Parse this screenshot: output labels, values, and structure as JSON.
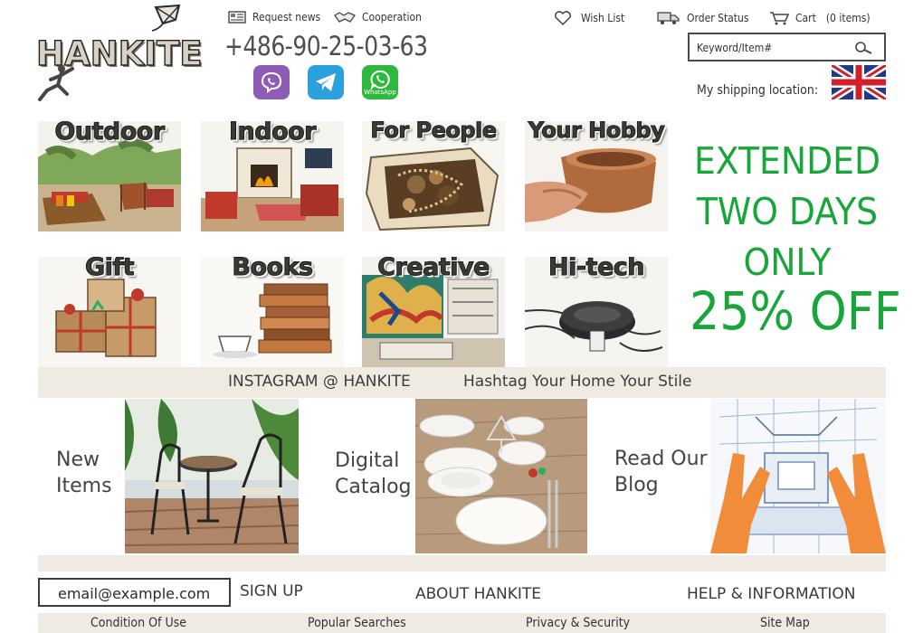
{
  "header": {
    "logo_text": "HANKITE",
    "links": {
      "request_news": "Request news",
      "cooperation": "Cooperation",
      "wish_list": "Wish List",
      "order_status": "Order Status",
      "cart": "Cart",
      "cart_count": "(0  items)"
    },
    "phone": "+486-90-25-03-63",
    "messengers": {
      "whatsapp_label": "WhatsApp"
    },
    "search": {
      "placeholder": "Keyword/Item#"
    },
    "shipping_label": "My shipping location:"
  },
  "categories": [
    {
      "label": "Outdoor"
    },
    {
      "label": "Indoor"
    },
    {
      "label": "For People"
    },
    {
      "label": "Your Hobby"
    },
    {
      "label": "Gift"
    },
    {
      "label": "Books"
    },
    {
      "label": "Creative"
    },
    {
      "label": "Hi-tech"
    }
  ],
  "promo": {
    "line1": "EXTENDED",
    "line2": "TWO DAYS",
    "line3": "ONLY",
    "line4": "25% OFF"
  },
  "instagram": {
    "handle": "INSTAGRAM @ HANKITE",
    "hashtag": "Hashtag Your Home Your Stile"
  },
  "features": {
    "new_items": [
      "New",
      "Items"
    ],
    "digital_catalog": [
      "Digital",
      "Catalog"
    ],
    "read_blog": [
      "Read Our",
      "Blog"
    ]
  },
  "footer": {
    "email_placeholder": "email@example.com",
    "sign_up": "SIGN UP",
    "about": "ABOUT HANKITE",
    "help": "HELP & INFORMATION",
    "links": [
      "Condition Of Use",
      "Popular Searches",
      "Privacy & Security",
      "Site Map"
    ]
  },
  "colors": {
    "promo_green": "#18a63a",
    "band_beige": "#efebe2",
    "viber": "#8e5bb5",
    "telegram": "#2aa0dc",
    "whatsapp": "#2db93e"
  }
}
